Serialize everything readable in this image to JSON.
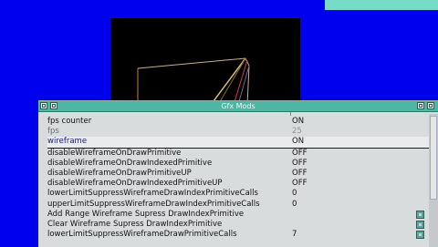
{
  "window": {
    "title": "Gfx Mods"
  },
  "rows": [
    {
      "name": "fps counter",
      "value": "ON"
    },
    {
      "name": "fps",
      "value": "25"
    },
    {
      "name": "wireframe",
      "value": "ON"
    },
    {
      "name": "disableWireframeOnDrawPrimitive",
      "value": "OFF"
    },
    {
      "name": "disableWireframeOnDrawIndexedPrimitive",
      "value": "OFF"
    },
    {
      "name": "disableWireframeOnDrawPrimitiveUP",
      "value": "OFF"
    },
    {
      "name": "disableWireframeOnDrawIndexedPrimitiveUP",
      "value": "OFF"
    },
    {
      "name": "lowerLimitSuppressWireframeDrawIndexPrimitiveCalls",
      "value": "0"
    },
    {
      "name": "upperLimitSuppressWireframeDrawIndexPrimitiveCalls",
      "value": "0"
    },
    {
      "name": "Add Range Wireframe Supress DrawIndexPrimitive",
      "value": ""
    },
    {
      "name": "Clear Wireframe Supress DrawIndexPrimitive",
      "value": ""
    },
    {
      "name": "lowerLimitSuppressWireframeDrawPrimitiveCalls",
      "value": "7"
    }
  ],
  "colors": {
    "desktop": "#0000ee",
    "titlebar": "#50b6a4",
    "panel": "#d9dcdd"
  }
}
